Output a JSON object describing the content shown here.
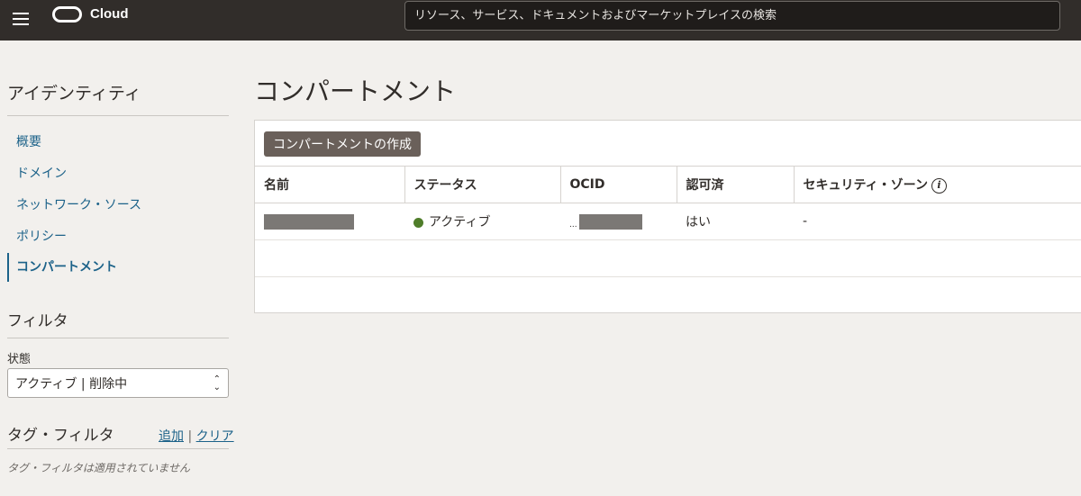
{
  "header": {
    "brand": "Cloud",
    "search_placeholder": "リソース、サービス、ドキュメントおよびマーケットプレイスの検索"
  },
  "sidebar": {
    "title": "アイデンティティ",
    "items": [
      {
        "label": "概要"
      },
      {
        "label": "ドメイン"
      },
      {
        "label": "ネットワーク・ソース"
      },
      {
        "label": "ポリシー"
      },
      {
        "label": "コンパートメント"
      }
    ],
    "filter_title": "フィルタ",
    "state_label": "状態",
    "state_value": "アクティブ | 削除中",
    "tag_filter_title": "タグ・フィルタ",
    "tag_add": "追加",
    "tag_separator": "|",
    "tag_clear": "クリア",
    "tag_empty": "タグ・フィルタは適用されていません"
  },
  "main": {
    "title": "コンパートメント",
    "create_button": "コンパートメントの作成",
    "columns": [
      "名前",
      "ステータス",
      "OCID",
      "認可済",
      "セキュリティ・ゾーン"
    ],
    "rows": [
      {
        "status": "アクティブ",
        "ocid_prefix": "...",
        "authorized": "はい",
        "security_zone": "-"
      }
    ]
  },
  "colors": {
    "topbar": "#312d2a",
    "link": "#1c6289",
    "status_active": "#4f7d2a",
    "button": "#6a605a"
  }
}
